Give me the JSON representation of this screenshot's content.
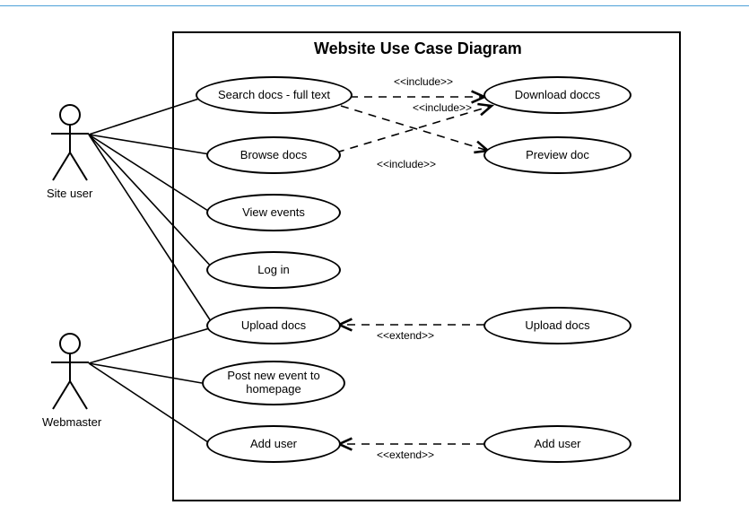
{
  "title": "Website Use Case Diagram",
  "actors": {
    "siteUser": {
      "label": "Site user"
    },
    "webmaster": {
      "label": "Webmaster"
    }
  },
  "useCases": {
    "searchDocs": {
      "label": "Search docs - full text"
    },
    "browseDocs": {
      "label": "Browse docs"
    },
    "viewEvents": {
      "label": "View events"
    },
    "logIn": {
      "label": "Log in"
    },
    "uploadDocs": {
      "label": "Upload docs"
    },
    "postEvent": {
      "label": "Post new event to homepage"
    },
    "addUser": {
      "label": "Add user"
    },
    "downloadDocs": {
      "label": "Download doccs"
    },
    "previewDoc": {
      "label": "Preview doc"
    },
    "uploadDocsR": {
      "label": "Upload docs"
    },
    "addUserR": {
      "label": "Add user"
    }
  },
  "relLabels": {
    "include1": "<<include>>",
    "include2": "<<include>>",
    "include3": "<<include>>",
    "extend1": "<<extend>>",
    "extend2": "<<extend>>"
  },
  "chart_data": {
    "type": "uml-use-case-diagram",
    "title": "Website Use Case Diagram",
    "system_boundary": "Website",
    "actors": [
      "Site user",
      "Webmaster"
    ],
    "use_cases": [
      "Search docs - full text",
      "Browse docs",
      "View events",
      "Log in",
      "Upload docs",
      "Post new event to homepage",
      "Add user",
      "Download doccs",
      "Preview doc"
    ],
    "associations": [
      {
        "actor": "Site user",
        "use_case": "Search docs - full text"
      },
      {
        "actor": "Site user",
        "use_case": "Browse docs"
      },
      {
        "actor": "Site user",
        "use_case": "View events"
      },
      {
        "actor": "Site user",
        "use_case": "Log in"
      },
      {
        "actor": "Site user",
        "use_case": "Upload docs"
      },
      {
        "actor": "Webmaster",
        "use_case": "Upload docs"
      },
      {
        "actor": "Webmaster",
        "use_case": "Post new event to homepage"
      },
      {
        "actor": "Webmaster",
        "use_case": "Add user"
      }
    ],
    "include": [
      {
        "from": "Search docs - full text",
        "to": "Download doccs"
      },
      {
        "from": "Search docs - full text",
        "to": "Preview doc"
      },
      {
        "from": "Browse docs",
        "to": "Download doccs"
      }
    ],
    "extend": [
      {
        "from": "Upload docs",
        "to": "Upload docs"
      },
      {
        "from": "Add user",
        "to": "Add user"
      }
    ]
  }
}
